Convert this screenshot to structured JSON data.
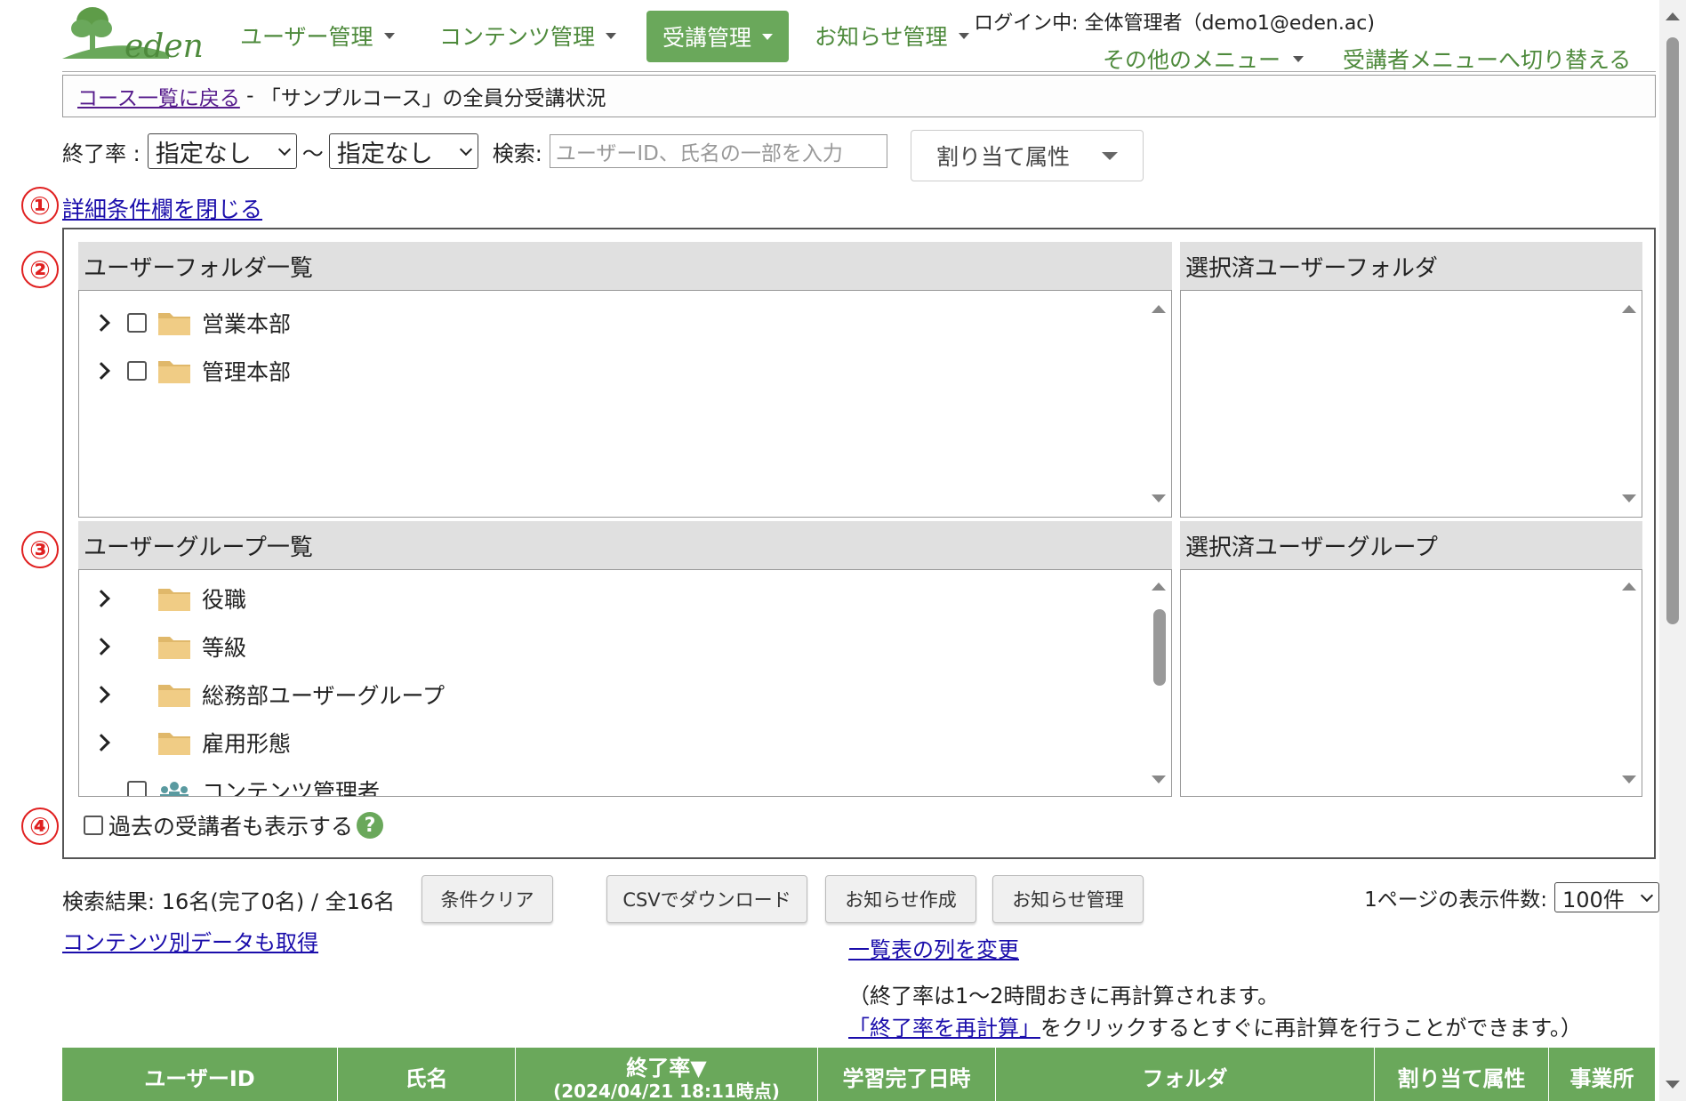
{
  "brand": {
    "logo_text": "eden",
    "accent": "#6aa85b"
  },
  "nav": {
    "items": [
      {
        "label": "ユーザー管理"
      },
      {
        "label": "コンテンツ管理"
      },
      {
        "label": "受講管理"
      },
      {
        "label": "お知らせ管理"
      }
    ],
    "login": "ログイン中: 全体管理者（demo1@eden.ac)",
    "other_menu": "その他のメニュー",
    "switch_menu": "受講者メニューへ切り替える"
  },
  "breadcrumb": {
    "back_link": "コース一覧に戻る",
    "separator": " - ",
    "title": "「サンプルコース」の全員分受講状況"
  },
  "filter": {
    "rate_label": "終了率 :",
    "rate_from": "指定なし",
    "tilde": "～",
    "rate_to": "指定なし",
    "search_label": "検索:",
    "search_placeholder": "ユーザーID、氏名の一部を入力",
    "attr_button": "割り当て属性"
  },
  "markers": [
    "①",
    "②",
    "③",
    "④"
  ],
  "close_detail_link": "詳細条件欄を閉じる",
  "folders": {
    "heading": "ユーザーフォルダ一覧",
    "selected_heading": "選択済ユーザーフォルダ",
    "items": [
      {
        "label": "営業本部"
      },
      {
        "label": "管理本部"
      }
    ]
  },
  "groups": {
    "heading": "ユーザーグループ一覧",
    "selected_heading": "選択済ユーザーグループ",
    "items": [
      {
        "label": "役職"
      },
      {
        "label": "等級"
      },
      {
        "label": "総務部ユーザーグループ"
      },
      {
        "label": "雇用形態"
      },
      {
        "label": "コンテンツ管理者"
      }
    ]
  },
  "past_label": "過去の受講者も表示する",
  "help_icon": "?",
  "results": {
    "summary": "検索結果: 16名(完了0名) / 全16名",
    "clear_button": "条件クリア",
    "csv_button": "CSVでダウンロード",
    "notice_create_button": "お知らせ作成",
    "notice_manage_button": "お知らせ管理",
    "per_page_label": "1ページの表示件数:",
    "per_page_value": "100件",
    "content_data_link": "コンテンツ別データも取得",
    "change_columns_link": "一覧表の列を変更",
    "note_line1": "（終了率は1～2時間おきに再計算されます。",
    "recalc_link": "「終了率を再計算」",
    "note_line2": "をクリックするとすぐに再計算を行うことができます。）"
  },
  "table": {
    "headers": [
      "ユーザーID",
      "氏名",
      "終了率▼",
      "学習完了日時",
      "フォルダ",
      "割り当て属性",
      "事業所"
    ],
    "rate_sub": "(2024/04/21 18:11時点)"
  }
}
